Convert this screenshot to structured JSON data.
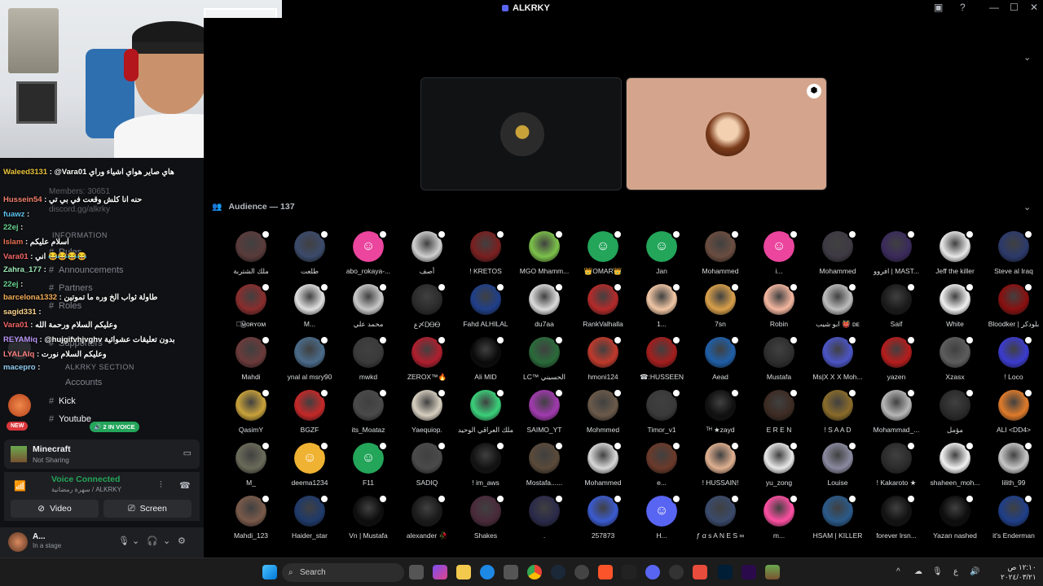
{
  "window": {
    "title": "ALKRKY",
    "controls": [
      "minimize",
      "maximize",
      "close"
    ]
  },
  "sidebar": {
    "ghost_texts": [
      "Members: 30651",
      "discord.gg/alkrky"
    ],
    "sections": [
      "INFORMATION",
      "ALKRKY SECTION"
    ],
    "channels": [
      "Rules",
      "Announcements",
      "Partners",
      "Roles",
      "Supporters",
      "Accounts",
      "Kick",
      "Youtube"
    ],
    "new_badge": "NEW",
    "voice_pill": "2 IN VOICE"
  },
  "chat": [
    {
      "name": "Waleed3131",
      "message": ": @Vara01 هاي صاير هواي اشياء وراي",
      "color": "#e8c23a"
    },
    {
      "name": "Hussein54",
      "message": ": حنه انا كلش وقعت في بي تي",
      "color": "#f07f6b"
    },
    {
      "name": "fuawz",
      "message": ":",
      "color": "#5bc0eb"
    },
    {
      "name": "22ej",
      "message": ":",
      "color": "#68d391"
    },
    {
      "name": "Islam",
      "message": ": اسلام عليكم",
      "color": "#e76f51"
    },
    {
      "name": "Vara01",
      "message": ": اني 😂😂😂😂",
      "color": "#f56565"
    },
    {
      "name": "Zahra_177",
      "message": ":",
      "color": "#9ae6b4"
    },
    {
      "name": "22ej",
      "message": ":",
      "color": "#68d391"
    },
    {
      "name": "barcelona1332",
      "message": ": طاولة ثواب الخ وره ما تموتين",
      "color": "#f6ad55"
    },
    {
      "name": "sagid331",
      "message": ":",
      "color": "#fbd38d"
    },
    {
      "name": "Vara01",
      "message": ": وعليكم السلام ورحمة الله",
      "color": "#f56565"
    },
    {
      "name": "REYAMiq",
      "message": ": @hujgifvhjvghv بدون تعليقات عشوائية",
      "color": "#b794f4"
    },
    {
      "name": "LYALAIq",
      "message": ": وعليكم السلام نورت",
      "color": "#fc8181"
    },
    {
      "name": "macepro",
      "message": ":",
      "color": "#90cdf4"
    }
  ],
  "activity": {
    "title": "Minecraft",
    "subtitle": "Not Sharing"
  },
  "voice": {
    "status": "Voice Connected",
    "location": "سهرة رمضانية / ALKRKY",
    "video_label": "Video",
    "screen_label": "Screen"
  },
  "user": {
    "name": "A...",
    "status": "In a stage"
  },
  "stage": {
    "audience_label": "Audience — 137"
  },
  "audience": [
    {
      "name": "ملك الشتربة",
      "color": "#5a3b3b"
    },
    {
      "name": "طلعت",
      "color": "#3b4a6b"
    },
    {
      "name": "abo_rokaya-...",
      "color": "#eb459e",
      "discord": true
    },
    {
      "name": "أصف",
      "color": "#cfcfcf"
    },
    {
      "name": "! KRETOS",
      "color": "#7a1f1f"
    },
    {
      "name": "MGO Mhamm...",
      "color": "#7cc24a"
    },
    {
      "name": "👑OMAR👑",
      "color": "#23a55a",
      "discord": true
    },
    {
      "name": "Jan",
      "color": "#23a55a",
      "discord": true
    },
    {
      "name": "Mohammed",
      "color": "#6b4d40"
    },
    {
      "name": "i...",
      "color": "#eb459e",
      "discord": true
    },
    {
      "name": "Mohammed",
      "color": "#3e3a44"
    },
    {
      "name": "افروو | MAST...",
      "color": "#3a2a5c"
    },
    {
      "name": "Jeff the killer",
      "color": "#e8e8e8"
    },
    {
      "name": "Steve al Iraq",
      "color": "#2c3a6b"
    },
    {
      "name": "ﾉ͜͡ᴍᴏʀʏᴏᴍ",
      "color": "#8a2d2d"
    },
    {
      "name": "M...",
      "color": "#e0e0e0"
    },
    {
      "name": "محمد علي",
      "color": "#c9c9c9"
    },
    {
      "name": "ع〆ᎠᎾᎾ",
      "color": "#2b2b2b"
    },
    {
      "name": "Fahd ALHILAL",
      "color": "#1f3f8a"
    },
    {
      "name": "du7aa",
      "color": "#dcdcdc"
    },
    {
      "name": "RankValhalla",
      "color": "#b52a2a"
    },
    {
      "name": "1...",
      "color": "#f2c7a5"
    },
    {
      "name": "7sn",
      "color": "#d9a04a"
    },
    {
      "name": "Robin",
      "color": "#f5b7a0"
    },
    {
      "name": "ابو شيب 👹 ᴅᴇ",
      "color": "#bdbdbd"
    },
    {
      "name": "Saif",
      "color": "#1a1a1a"
    },
    {
      "name": "White",
      "color": "#f0f0f0"
    },
    {
      "name": "Bloodker | بلودكر",
      "color": "#8a0f0f"
    },
    {
      "name": "Mahdi",
      "color": "#6b3a3a"
    },
    {
      "name": "ynal al msry90",
      "color": "#4a6b8a"
    },
    {
      "name": "mwkd",
      "color": "#3a3a3a"
    },
    {
      "name": "ZEROX™🔥",
      "color": "#b01e2e"
    },
    {
      "name": "Ali MID",
      "color": "#0a0a0a"
    },
    {
      "name": "LC™ الحسيني",
      "color": "#2a6b3a"
    },
    {
      "name": "hmoni124",
      "color": "#c0392b"
    },
    {
      "name": "☎:HUSSEEN",
      "color": "#a51d1d"
    },
    {
      "name": "Aead",
      "color": "#1f5fa8"
    },
    {
      "name": "Mustafa",
      "color": "#2e2e2e"
    },
    {
      "name": "Ms|X X X Moh...",
      "color": "#4b55c6"
    },
    {
      "name": "yazen",
      "color": "#b71c1c"
    },
    {
      "name": "Xzasx",
      "color": "#5d5d5d"
    },
    {
      "name": "! Loco",
      "color": "#3b3bd1"
    },
    {
      "name": "QasimY",
      "color": "#c9a23a"
    },
    {
      "name": "BGZF",
      "color": "#c62828"
    },
    {
      "name": "its_Moataz",
      "color": "#4a4a4a"
    },
    {
      "name": "Yaequiop.",
      "color": "#d7cfc0"
    },
    {
      "name": "ملك العراقي الوحيد",
      "color": "#3ad17a"
    },
    {
      "name": "SAIMO_YT",
      "color": "#a23ab0"
    },
    {
      "name": "Mohmmed",
      "color": "#6b5a4a"
    },
    {
      "name": "Timor_v1",
      "color": "#3a3a3a"
    },
    {
      "name": "ᵀᴴ ★zayd",
      "color": "#101010"
    },
    {
      "name": "E R E N",
      "color": "#3d2b23"
    },
    {
      "name": "! S A A D",
      "color": "#8a6b2a"
    },
    {
      "name": "Mohammad_...",
      "color": "#b7b7b7"
    },
    {
      "name": "مؤمل",
      "color": "#2a2a2a"
    },
    {
      "name": "ALI <DD4>",
      "color": "#e07b2a"
    },
    {
      "name": "M_",
      "color": "#6b6b5a"
    },
    {
      "name": "deema1234",
      "color": "#f0b232",
      "discord": true
    },
    {
      "name": "F11",
      "color": "#23a55a",
      "discord": true
    },
    {
      "name": "SADIQ",
      "color": "#4a4a4a"
    },
    {
      "name": "! im_aws",
      "color": "#121212"
    },
    {
      "name": "Mostafa......",
      "color": "#5a4a3a"
    },
    {
      "name": "Mohammed",
      "color": "#d8d8d8"
    },
    {
      "name": "e...",
      "color": "#6b3a2a"
    },
    {
      "name": "! HUSSAIN!",
      "color": "#e0b090"
    },
    {
      "name": "yu_zong",
      "color": "#e8e8e8"
    },
    {
      "name": "Louise",
      "color": "#8a8aa0"
    },
    {
      "name": "! Kakaroto ★",
      "color": "#2b2b2b"
    },
    {
      "name": "shaheen_moh...",
      "color": "#f2f2f2"
    },
    {
      "name": "lilith_99",
      "color": "#c7c7c7"
    },
    {
      "name": "Mahdi_123",
      "color": "#7a5a4a"
    },
    {
      "name": "Haider_star",
      "color": "#1f3a6b"
    },
    {
      "name": "Vn | Mustafa",
      "color": "#0d0d0d"
    },
    {
      "name": "alexander 🥀",
      "color": "#1a1a1a"
    },
    {
      "name": "Shakes",
      "color": "#4a2a3a"
    },
    {
      "name": ".",
      "color": "#2a2a4a"
    },
    {
      "name": "257873",
      "color": "#3b5bd1"
    },
    {
      "name": "H...",
      "color": "#5865f2",
      "discord": true
    },
    {
      "name": "ƒ ꭤ s A N E S ∞",
      "color": "#3a4a6b"
    },
    {
      "name": "m...",
      "color": "#ff4fa3"
    },
    {
      "name": "HSAM | KILLER",
      "color": "#2a5a8a"
    },
    {
      "name": "forever lrsn...",
      "color": "#121212"
    },
    {
      "name": "Yazan nashed",
      "color": "#0d0d0d"
    },
    {
      "name": "it's Enderman",
      "color": "#1f3f8a"
    }
  ],
  "taskbar": {
    "search_label": "Search",
    "time": "١٢:١٠ ص",
    "date": "٢٠٢٤/٠٣/٢١",
    "lang": "ع"
  },
  "colors": {
    "discord_green": "#23a55a",
    "discord_blurple": "#5865f2",
    "background": "#000000"
  }
}
